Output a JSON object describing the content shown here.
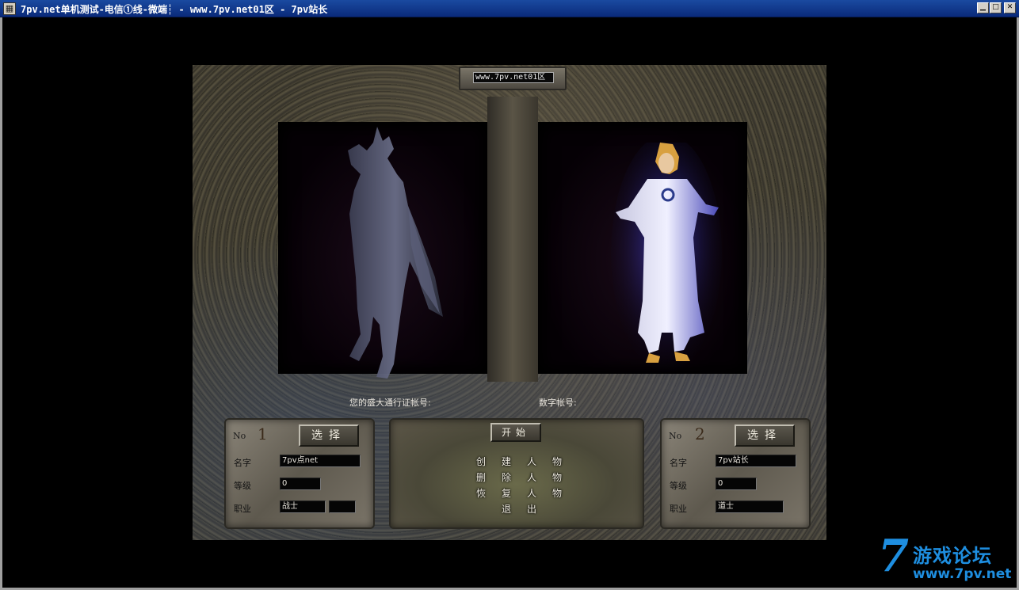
{
  "window": {
    "title": "7pv.net单机测试-电信①线-微端┆ - www.7pv.net01区 - 7pv站长",
    "minimize_icon": "minimize-icon",
    "maximize_icon": "maximize-icon",
    "close_icon": "close-icon"
  },
  "server": {
    "name": "www.7pv.net01区"
  },
  "account": {
    "passport_label": "您的盛大通行证帐号:",
    "digital_label": "数字帐号:"
  },
  "slot1": {
    "no_label": "No",
    "number": "1",
    "select_label": "选择",
    "name_label": "名字",
    "name_value": "7pv点net",
    "level_label": "等级",
    "level_value": "0",
    "job_label": "职业",
    "job_value": "战士"
  },
  "slot2": {
    "no_label": "No",
    "number": "2",
    "select_label": "选择",
    "name_label": "名字",
    "name_value": "7pv站长",
    "level_label": "等级",
    "level_value": "0",
    "job_label": "职业",
    "job_value": "道士"
  },
  "menu": {
    "start_label": "开始",
    "create": [
      "创",
      "建",
      "人",
      "物"
    ],
    "delete": [
      "删",
      "除",
      "人",
      "物"
    ],
    "restore": [
      "恢",
      "复",
      "人",
      "物"
    ],
    "exit": [
      "退",
      "出"
    ]
  },
  "watermark": {
    "seven": "7",
    "text": "游戏论坛",
    "url": "www.7pv.net"
  },
  "colors": {
    "titlebar": "#0a2a7a",
    "watermark": "#1e8ee0"
  }
}
